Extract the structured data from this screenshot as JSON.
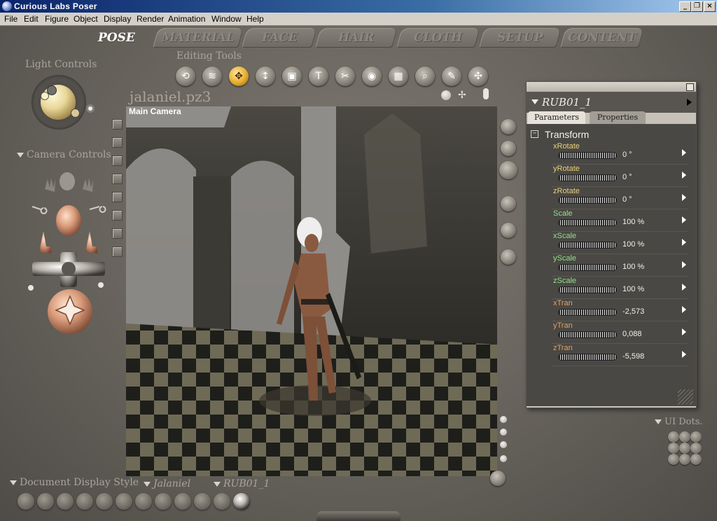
{
  "window": {
    "title": "Curious Labs Poser",
    "buttons": [
      "_",
      "❐",
      "×"
    ]
  },
  "menu": [
    "File",
    "Edit",
    "Figure",
    "Object",
    "Display",
    "Render",
    "Animation",
    "Window",
    "Help"
  ],
  "rooms": [
    {
      "label": "POSE",
      "active": true
    },
    {
      "label": "MATERIAL"
    },
    {
      "label": "FACE"
    },
    {
      "label": "HAIR"
    },
    {
      "label": "CLOTH"
    },
    {
      "label": "SETUP"
    },
    {
      "label": "CONTENT"
    }
  ],
  "left": {
    "light_title": "Light Controls",
    "camera_title": "Camera Controls"
  },
  "editing_tools": {
    "title": "Editing Tools",
    "active_index": 2,
    "icons": [
      "rotate-icon",
      "twist-icon",
      "translate-icon",
      "translate-in-out-icon",
      "scale-icon",
      "taper-icon",
      "chain-break-icon",
      "color-icon",
      "grouping-icon",
      "view-magnifier-icon",
      "morph-brush-icon",
      "direct-manipulation-icon"
    ],
    "glyphs": [
      "⟲",
      "≋",
      "✥",
      "↕",
      "▣",
      "T",
      "✂",
      "◉",
      "▦",
      "⌕",
      "✎",
      "✣"
    ]
  },
  "document": {
    "filename": "jalaniel.pz3",
    "camera_label": "Main Camera"
  },
  "parameters": {
    "actor": "RUB01_1",
    "tabs": [
      "Parameters",
      "Properties"
    ],
    "group": "Transform",
    "items": [
      {
        "name": "xRotate",
        "value": "0 °",
        "color": "#e8d07a"
      },
      {
        "name": "yRotate",
        "value": "0 °",
        "color": "#e8d07a"
      },
      {
        "name": "zRotate",
        "value": "0 °",
        "color": "#e8d07a"
      },
      {
        "name": "Scale",
        "value": "100 %",
        "color": "#8fe08a"
      },
      {
        "name": "xScale",
        "value": "100 %",
        "color": "#8fe08a"
      },
      {
        "name": "yScale",
        "value": "100 %",
        "color": "#8fe08a"
      },
      {
        "name": "zScale",
        "value": "100 %",
        "color": "#8fe08a"
      },
      {
        "name": "xTran",
        "value": "-2,573",
        "color": "#e0a060"
      },
      {
        "name": "yTran",
        "value": "0,088",
        "color": "#e0a060"
      },
      {
        "name": "zTran",
        "value": "-5,598",
        "color": "#e0a060"
      }
    ]
  },
  "ui_dots": {
    "label": "UI Dots."
  },
  "bottom": {
    "display_style": "Document Display Style",
    "figure": "Jalaniel",
    "actor": "RUB01_1"
  }
}
